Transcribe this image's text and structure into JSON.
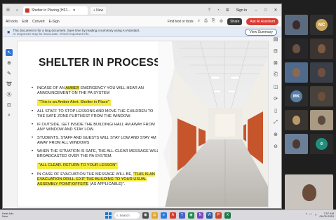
{
  "browser": {
    "tab_title": "Shelter in Placing (HF1...",
    "new_tab_label": "+ New",
    "signin_label": "Sign in",
    "toolbar": {
      "all_tools": "All tools",
      "edit": "Edit",
      "convert": "Convert",
      "esign": "E-Sign",
      "find_text": "Find text or tools",
      "share": "Share",
      "ask_assistant": "Ask AI Assistant"
    },
    "infobar": {
      "message": "This document is for a long document. Save time by reading a summary using AI Assistant.",
      "sub": "AI responses may be inaccurate. Check important info.",
      "view_summary": "View Summary"
    }
  },
  "slide": {
    "title": "SHELTER IN PROCESS",
    "bullets": [
      {
        "pre": "INCASE OF AN ",
        "hl": "AMBER",
        "post": " EMERGENCY YOU WILL HEAR AN ANNOUNCEMENT ON THE PA System"
      },
      {
        "pre": "ALL STAFF TO STOP LESSONS AND MOVE THE CHILDREN TO THE SAFE ZONE FURTHEST FROM THE WINDOW.",
        "hl": "",
        "post": ""
      },
      {
        "pre": "IF OUTSIDE, GET INSIDE THE BUILDING/ HALL 4M AWAY FROM ANY WINDOW AND STAY LOW.",
        "hl": "",
        "post": ""
      },
      {
        "pre": "STUDENTS, STAFF and GUESTS WILL STAY LOW AND STAY 4M AWAY FROM ALL WINDOWS",
        "hl": "",
        "post": ""
      },
      {
        "pre": "WHEN THE SITUATION IS SAFE, THE ALL-CLEAR MESSAGE WILL BROADCASTED OVER THE PA SYSTEM.",
        "hl": "",
        "post": ""
      },
      {
        "pre": "IN CASE OF EVACUATION THE MESSAGE WILL BE, ",
        "hl": "\"THIS IS AN EVACUATION DRILL. EXIT THE BUILDING TO YOUR USUAL ASSEMBLY POINT/OFFSITE",
        "post": " (AS APPLICABLE)\"."
      }
    ],
    "quote_1": "\"This is an Amber Alert. Shelter in Place\"",
    "quote_2": "\"ALL CLEAR. RETURN TO YOUR LESSON\""
  },
  "participants": [
    {
      "initials": "MC",
      "color": "#c9a55a"
    },
    {
      "initials": "MK",
      "color": "#5a7fa6"
    }
  ],
  "taskbar": {
    "search_label": "Search",
    "time": "7:57 AM",
    "date": "06-05-2024",
    "weather_top": "Heat Adv.",
    "weather_bottom": "Now"
  },
  "colors": {
    "highlight": "#f4ec3a",
    "accent": "#d93b32"
  }
}
